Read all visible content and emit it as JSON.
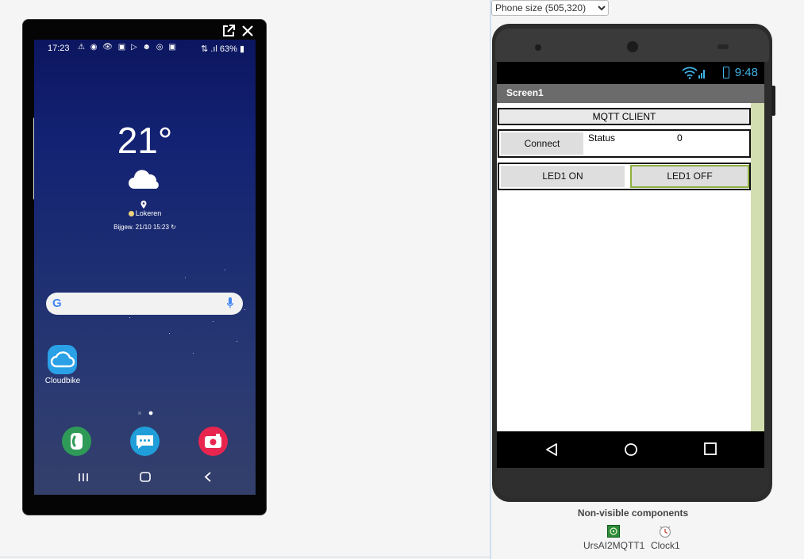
{
  "mirror": {
    "status_time": "17:23",
    "status_icons": "⚠ ◉ 👁 ▣ ▷ ☻ ◎ ▣",
    "status_right": "⇅ .ıl 63% ▮",
    "weather": {
      "temperature": "21°",
      "city": "Lokeren",
      "updated": "Bijgew. 21/10 15:23 ↻"
    },
    "home_app_label": "Cloudbike",
    "nav_icons": [
      "recent-apps-icon",
      "home-icon",
      "back-icon"
    ]
  },
  "viewer": {
    "phone_size_options": [
      "Phone size (505,320)"
    ],
    "phone_size_selected": "Phone size (505,320)",
    "status_time": "9:48",
    "screen_title": "Screen1",
    "title_label": "MQTT CLIENT",
    "connect_label": "Connect",
    "status_label": "Status",
    "status_value": "0",
    "led_on_label": "LED1 ON",
    "led_off_label": "LED1 OFF"
  },
  "nonvisible": {
    "title": "Non-visible components",
    "items": [
      {
        "label": "UrsAI2MQTT1",
        "icon": "mqtt-extension-icon"
      },
      {
        "label": "Clock1",
        "icon": "clock-icon"
      }
    ]
  },
  "colors": {
    "ai_status_accent": "#3fb3e8",
    "led_off_border": "#8fb241",
    "scroll_strip": "#d2ddb0"
  }
}
